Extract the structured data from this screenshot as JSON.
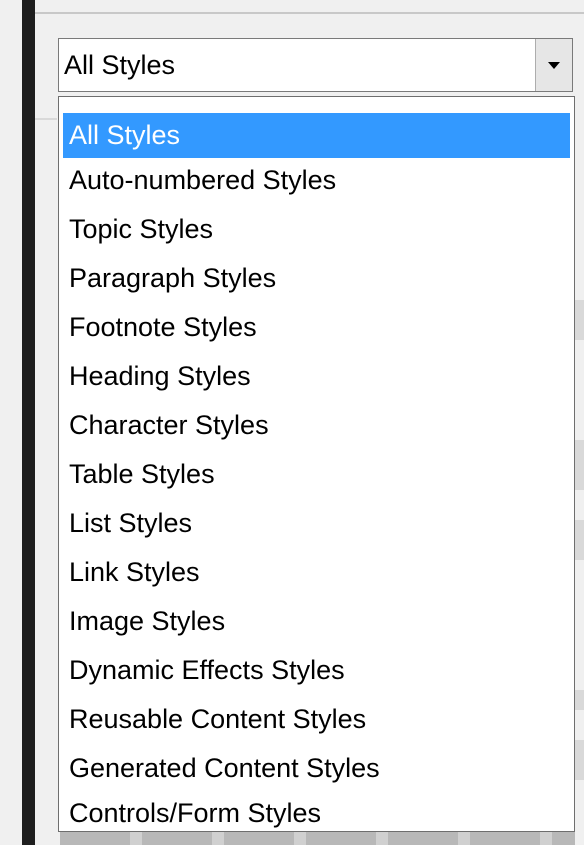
{
  "style_filter": {
    "selected_value": "All Styles",
    "arrow_icon": "chevron-down-icon",
    "options": [
      {
        "label": "All Styles",
        "selected": true
      },
      {
        "label": "Auto-numbered Styles",
        "selected": false
      },
      {
        "label": "Topic Styles",
        "selected": false
      },
      {
        "label": "Paragraph Styles",
        "selected": false
      },
      {
        "label": "Footnote Styles",
        "selected": false
      },
      {
        "label": "Heading Styles",
        "selected": false
      },
      {
        "label": "Character Styles",
        "selected": false
      },
      {
        "label": "Table Styles",
        "selected": false
      },
      {
        "label": "List Styles",
        "selected": false
      },
      {
        "label": "Link Styles",
        "selected": false
      },
      {
        "label": "Image Styles",
        "selected": false
      },
      {
        "label": "Dynamic Effects Styles",
        "selected": false
      },
      {
        "label": "Reusable Content Styles",
        "selected": false
      },
      {
        "label": "Generated Content Styles",
        "selected": false
      },
      {
        "label": "Controls/Form Styles",
        "selected": false
      }
    ]
  },
  "colors": {
    "selection_highlight": "#3399ff",
    "selection_text": "#ffffff",
    "panel_background": "#f0f0f0",
    "left_bar": "#1e1e1e"
  }
}
